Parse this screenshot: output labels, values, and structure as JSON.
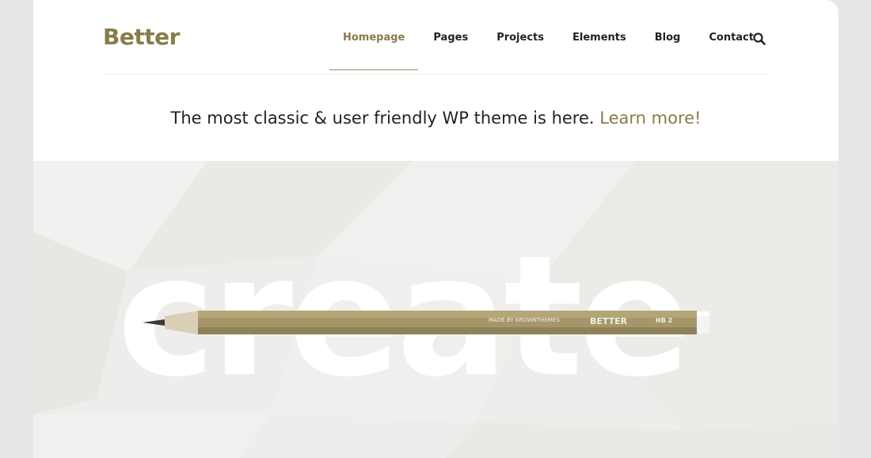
{
  "brand": {
    "logo": "Better",
    "accent_color": "#8a7b4a"
  },
  "nav": {
    "items": [
      {
        "label": "Homepage",
        "active": true
      },
      {
        "label": "Pages"
      },
      {
        "label": "Projects"
      },
      {
        "label": "Elements"
      },
      {
        "label": "Blog"
      },
      {
        "label": "Contact"
      }
    ],
    "search_icon": "search-icon"
  },
  "tagline": {
    "text": "The most classic & user friendly WP theme is here.",
    "link": "Learn more!"
  },
  "hero": {
    "word": "create",
    "pencil": {
      "maker": "MADE BY KROWNTHEMES",
      "brand": "BETTER",
      "grade": "HB 2"
    }
  }
}
